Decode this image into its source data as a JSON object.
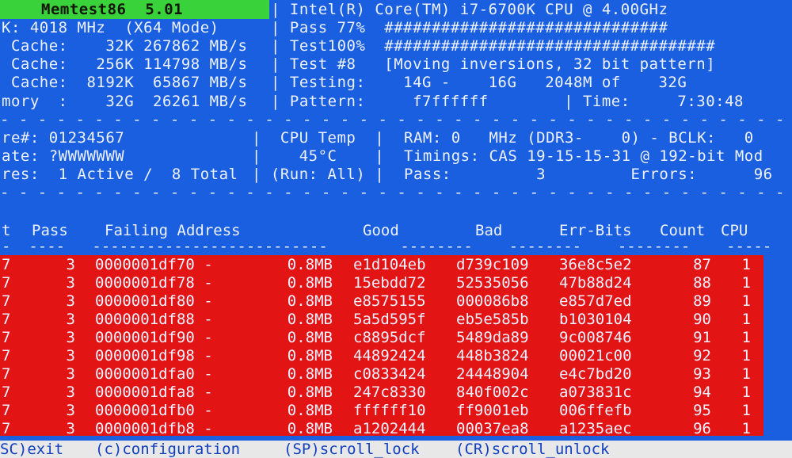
{
  "header": {
    "title": "Memtest86  5.01",
    "cpu": "| Intel(R) Core(TM) i7-6700K CPU @ 4.00GHz",
    "left_lines": [
      "K: 4018 MHz  (X64 Mode)",
      " Cache:    32K 267862 MB/s",
      " Cache:   256K 114798 MB/s",
      " Cache:  8192K  65867 MB/s",
      "mory  :    32G  26261 MB/s"
    ],
    "right_lines": [
      "| Pass 77%  ##############################",
      "| Test100%  ###################################",
      "| Test #8   [Moving inversions, 32 bit pattern]",
      "| Testing:    14G -    16G   2048M of    32G",
      "| Pattern:     f7ffffff        | Time:     7:30:48"
    ]
  },
  "info": {
    "col1": [
      "re#: 01234567",
      "ate: ?WWWWWWW",
      "res:  1 Active /  8 Total"
    ],
    "col2": [
      "|  CPU Temp  |",
      "|    45°C    |",
      "| (Run: All) |"
    ],
    "col3": [
      "RAM: 0   MHz (DDR3-    0) - BCLK:   0",
      "Timings: CAS 19-15-15-31 @ 192-bit Mod",
      "Pass:         3         Errors:      96"
    ]
  },
  "table": {
    "headers": [
      "t",
      "Pass",
      "Failing Address",
      "Good",
      "Bad",
      "Err-Bits",
      "Count",
      "CPU"
    ],
    "underline": "-  ----   --------------------------        --------    --------    --------    -----  ---",
    "rows": [
      [
        "7",
        "3",
        "0000001df70 -",
        "0.8MB",
        "e1d104eb",
        "d739c109",
        "36e8c5e2",
        "87",
        "1"
      ],
      [
        "7",
        "3",
        "0000001df78 -",
        "0.8MB",
        "15ebdd72",
        "52535056",
        "47b88d24",
        "88",
        "1"
      ],
      [
        "7",
        "3",
        "0000001df80 -",
        "0.8MB",
        "e8575155",
        "000086b8",
        "e857d7ed",
        "89",
        "1"
      ],
      [
        "7",
        "3",
        "0000001df88 -",
        "0.8MB",
        "5a5d595f",
        "eb5e585b",
        "b1030104",
        "90",
        "1"
      ],
      [
        "7",
        "3",
        "0000001df90 -",
        "0.8MB",
        "c8895dcf",
        "5489da89",
        "9c008746",
        "91",
        "1"
      ],
      [
        "7",
        "3",
        "0000001df98 -",
        "0.8MB",
        "44892424",
        "448b3824",
        "00021c00",
        "92",
        "1"
      ],
      [
        "7",
        "3",
        "0000001dfa0 -",
        "0.8MB",
        "c0833424",
        "24448904",
        "e4c7bd20",
        "93",
        "1"
      ],
      [
        "7",
        "3",
        "0000001dfa8 -",
        "0.8MB",
        "247c8330",
        "840f002c",
        "a073831c",
        "94",
        "1"
      ],
      [
        "7",
        "3",
        "0000001dfb0 -",
        "0.8MB",
        "ffffff10",
        "ff9001eb",
        "006ffefb",
        "95",
        "1"
      ],
      [
        "7",
        "3",
        "0000001dfb8 -",
        "0.8MB",
        "a1202444",
        "00037ea8",
        "a1235aec",
        "96",
        "1"
      ]
    ]
  },
  "footer": {
    "exit": "SC)exit",
    "config": "(c)configuration",
    "scroll_lock": "(SP)scroll_lock",
    "scroll_unlock": "(CR)scroll_unlock"
  },
  "colors": {
    "background": "#1a5fe0",
    "title_bar": "#3ad23a",
    "error_block": "#e21414",
    "footer": "#e8e8e8"
  }
}
